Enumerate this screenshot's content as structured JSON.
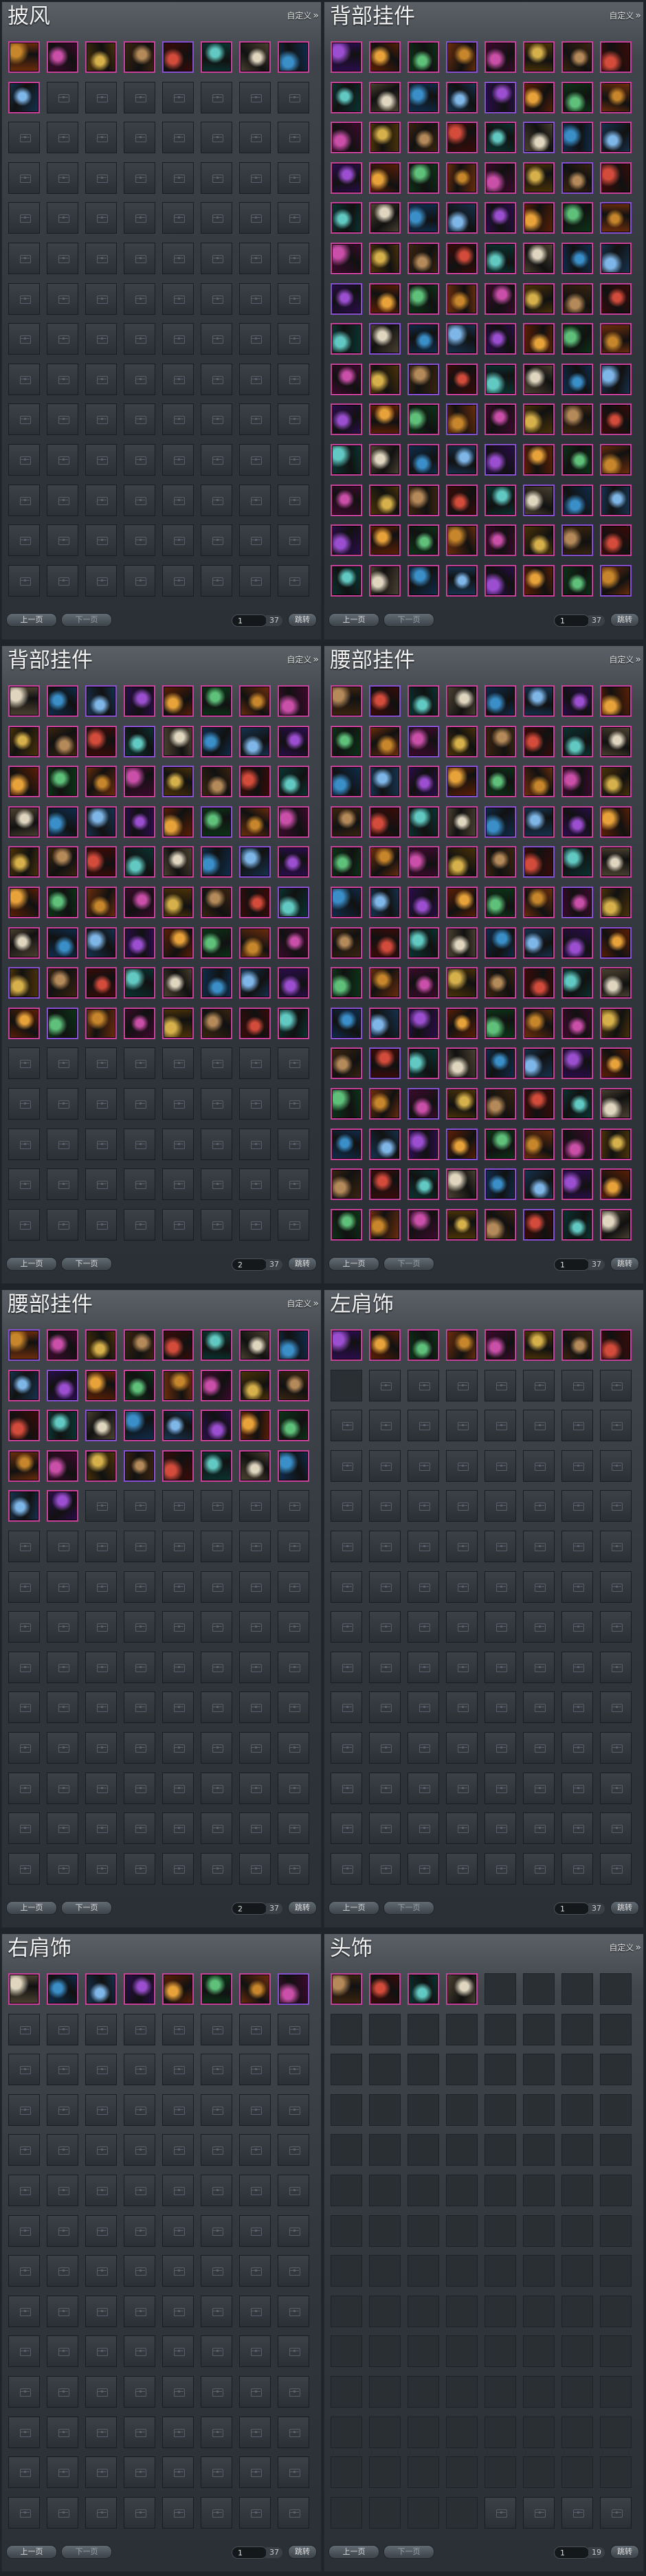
{
  "common": {
    "custom_label": "自定义",
    "prev_label": "上一页",
    "next_label": "下一页",
    "jump_label": "跳转"
  },
  "panels": [
    {
      "title": "披风",
      "page": "1",
      "total": "37",
      "filled": 9,
      "blank": 0,
      "custom": true,
      "next_active": false
    },
    {
      "title": "背部挂件",
      "page": "1",
      "total": "37",
      "filled": 112,
      "blank": 0,
      "custom": true,
      "next_active": false
    },
    {
      "title": "背部挂件",
      "page": "2",
      "total": "37",
      "filled": 72,
      "blank": 0,
      "custom": true,
      "next_active": true
    },
    {
      "title": "腰部挂件",
      "page": "1",
      "total": "37",
      "filled": 112,
      "blank": 0,
      "custom": true,
      "next_active": false
    },
    {
      "title": "腰部挂件",
      "page": "2",
      "total": "37",
      "filled": 34,
      "blank": 0,
      "custom": true,
      "next_active": true
    },
    {
      "title": "左肩饰",
      "page": "1",
      "total": "37",
      "filled": 8,
      "blank": 1,
      "custom": false,
      "next_active": false
    },
    {
      "title": "右肩饰",
      "page": "1",
      "total": "37",
      "filled": 8,
      "blank": 0,
      "custom": false,
      "next_active": false
    },
    {
      "title": "头饰",
      "page": "1",
      "total": "19",
      "filled": 4,
      "blank": 104,
      "custom": true,
      "next_active": false
    }
  ],
  "colors": {
    "item_border": "#c8409a",
    "item_border_alt": "#8a4fd0"
  }
}
